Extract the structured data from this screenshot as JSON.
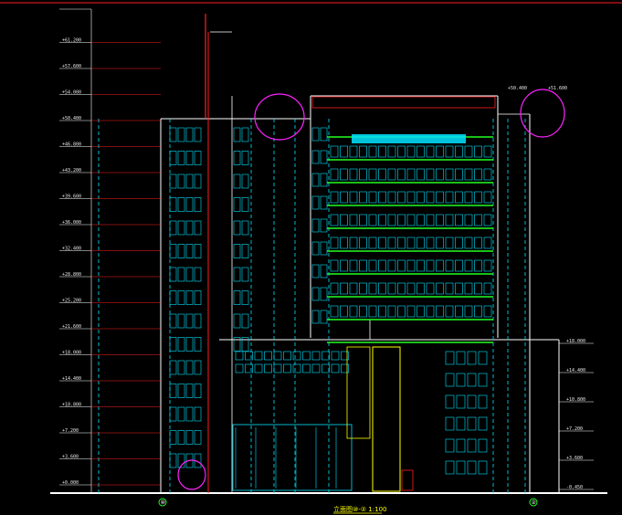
{
  "drawing": {
    "title": "立面图⑩-②  1:100",
    "axis_left": "⑩",
    "axis_right": "②"
  },
  "levels_left": [
    "+0.000",
    "+3.600",
    "+7.200",
    "+10.800",
    "+14.400",
    "+18.000",
    "+21.600",
    "+25.200",
    "+28.800",
    "+32.400",
    "+36.000",
    "+39.600",
    "+43.200",
    "+46.800",
    "+50.400",
    "+54.000",
    "+57.600",
    "+61.200"
  ],
  "levels_right": [
    "-0.450",
    "+3.600",
    "+7.200",
    "+10.800",
    "+14.400",
    "+18.000"
  ],
  "roof_labels": [
    "+50.400",
    "+51.600"
  ],
  "colors": {
    "background": "#000000",
    "window_cyan": "#00e5ff",
    "wall_white": "#ffffff",
    "red": "#ff2020",
    "green": "#22ff22",
    "yellow": "#ffff00",
    "magenta": "#ff22ff",
    "blue": "#3a5cff"
  }
}
